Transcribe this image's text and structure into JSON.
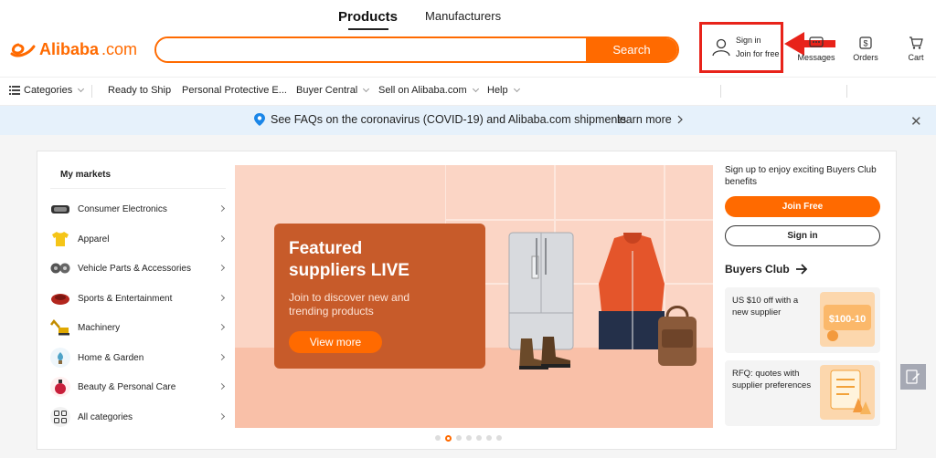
{
  "header": {
    "tabs": [
      {
        "label": "Products",
        "active": true
      },
      {
        "label": "Manufacturers",
        "active": false
      }
    ],
    "logo_text": "Alibaba",
    "logo_suffix": ".com",
    "search": {
      "value": "",
      "button": "Search"
    },
    "signin": {
      "line1": "Sign in",
      "line2": "Join for free"
    },
    "messages_label": "Messages",
    "orders_label": "Orders",
    "cart_label": "Cart"
  },
  "nav": {
    "categories_label": "Categories",
    "items": [
      {
        "label": "Ready to Ship"
      },
      {
        "label": "Personal Protective E..."
      },
      {
        "label": "Buyer Central"
      },
      {
        "label": "Sell on Alibaba.com"
      },
      {
        "label": "Help"
      }
    ]
  },
  "notice": {
    "message": "See FAQs on the coronavirus (COVID-19) and Alibaba.com shipments",
    "link": "learn more",
    "close": "✕"
  },
  "markets": {
    "title": "My markets",
    "items": [
      {
        "label": "Consumer Electronics",
        "icon": "electronics-icon"
      },
      {
        "label": "Apparel",
        "icon": "apparel-icon"
      },
      {
        "label": "Vehicle Parts & Accessories",
        "icon": "vehicle-parts-icon"
      },
      {
        "label": "Sports & Entertainment",
        "icon": "sports-icon"
      },
      {
        "label": "Machinery",
        "icon": "machinery-icon"
      },
      {
        "label": "Home & Garden",
        "icon": "home-garden-icon"
      },
      {
        "label": "Beauty & Personal Care",
        "icon": "beauty-icon"
      },
      {
        "label": "All categories",
        "icon": "all-categories-icon"
      }
    ]
  },
  "banner": {
    "title_line1": "Featured",
    "title_line2": "suppliers LIVE",
    "subtitle_line1": "Join to discover new and",
    "subtitle_line2": "trending products",
    "cta": "View more",
    "slide_count": 7,
    "active_slide": 2
  },
  "sidebar": {
    "promo": "Sign up to enjoy exciting Buyers Club benefits",
    "join_button": "Join Free",
    "signin_button": "Sign in",
    "club_title": "Buyers Club",
    "cards": [
      {
        "text": "US $10 off with a new supplier",
        "thumb_text": "$100-10"
      },
      {
        "text": "RFQ: quotes with supplier preferences"
      }
    ]
  },
  "colors": {
    "brand": "#ff6a00",
    "highlight": "#e8231a",
    "notice_bg": "#e6f1fb"
  }
}
